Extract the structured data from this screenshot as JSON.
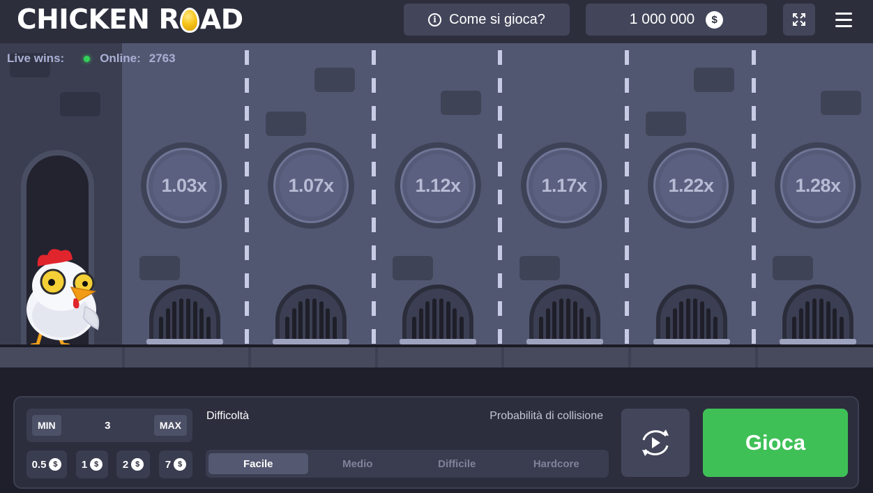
{
  "header": {
    "logo_left": "CHICKEN R",
    "logo_right": "AD",
    "how_to_play": "Come si gioca?",
    "balance": "1 000 000",
    "currency_symbol": "$"
  },
  "live": {
    "live_wins_label": "Live wins:",
    "online_label": "Online:",
    "online_count": "2763"
  },
  "multipliers": [
    "1.03x",
    "1.07x",
    "1.12x",
    "1.17x",
    "1.22x",
    "1.28x"
  ],
  "bet": {
    "min_label": "MIN",
    "value": "3",
    "max_label": "MAX",
    "quick_amounts": [
      "0.5",
      "1",
      "2",
      "7"
    ]
  },
  "difficulty": {
    "label": "Difficoltà",
    "collision_label": "Probabilità di collisione",
    "options": [
      "Facile",
      "Medio",
      "Difficile",
      "Hardcore"
    ],
    "selected": "Facile"
  },
  "play_label": "Gioca",
  "colors": {
    "play_green": "#3fc057",
    "panel_bg": "#2c2e3e",
    "game_bg": "#525771",
    "online_dot": "#34d058"
  },
  "icons": {
    "info": "info-icon",
    "coin": "dollar-coin-icon",
    "fullscreen": "fullscreen-icon",
    "menu": "hamburger-menu-icon",
    "auto": "auto-play-icon"
  }
}
